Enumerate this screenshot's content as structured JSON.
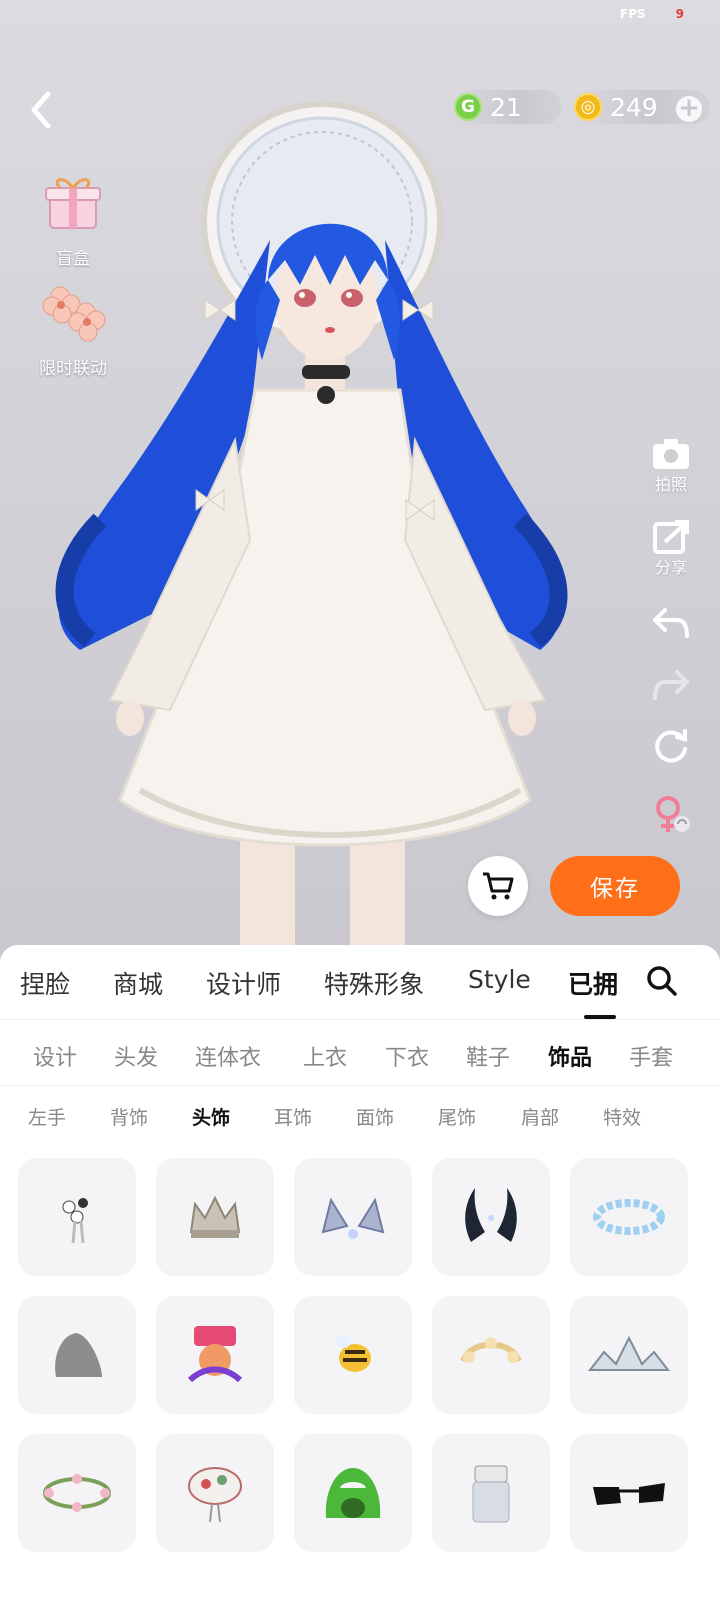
{
  "fps": {
    "label": "FPS",
    "value": "9"
  },
  "currency": {
    "green": "21",
    "gold": "249"
  },
  "side_events": [
    {
      "label": "盲盒",
      "icon": "gift-box-icon"
    },
    {
      "label": "限时联动",
      "icon": "flower-icon"
    }
  ],
  "right_tools": [
    {
      "label": "拍照",
      "icon": "camera-icon"
    },
    {
      "label": "分享",
      "icon": "share-icon"
    },
    {
      "label": "",
      "icon": "undo-icon"
    },
    {
      "label": "",
      "icon": "redo-icon"
    },
    {
      "label": "",
      "icon": "reset-icon"
    },
    {
      "label": "",
      "icon": "gender-switch-icon"
    }
  ],
  "save_label": "保存",
  "main_tabs": [
    {
      "label": "捏脸"
    },
    {
      "label": "商城"
    },
    {
      "label": "设计师"
    },
    {
      "label": "特殊形象"
    },
    {
      "label": "Style"
    },
    {
      "label": "已拥"
    }
  ],
  "sub_tabs": [
    {
      "label": "设计"
    },
    {
      "label": "头发"
    },
    {
      "label": "连体衣"
    },
    {
      "label": "上衣"
    },
    {
      "label": "下衣"
    },
    {
      "label": "鞋子"
    },
    {
      "label": "饰品"
    },
    {
      "label": "手套"
    }
  ],
  "third_tabs": [
    {
      "label": "左手"
    },
    {
      "label": "背饰"
    },
    {
      "label": "头饰"
    },
    {
      "label": "耳饰"
    },
    {
      "label": "面饰"
    },
    {
      "label": "尾饰"
    },
    {
      "label": "肩部"
    },
    {
      "label": "特效"
    }
  ],
  "items": [
    {
      "name": "flower-headpiece"
    },
    {
      "name": "silver-crown"
    },
    {
      "name": "cat-ears"
    },
    {
      "name": "dark-horns"
    },
    {
      "name": "blue-flower-wreath"
    },
    {
      "name": "grey-hat"
    },
    {
      "name": "233-robot-headband"
    },
    {
      "name": "bee-hairclip"
    },
    {
      "name": "flower-crown"
    },
    {
      "name": "silver-tiara"
    },
    {
      "name": "pink-flower-wreath"
    },
    {
      "name": "floral-beret"
    },
    {
      "name": "green-dino-hood"
    },
    {
      "name": "visor"
    },
    {
      "name": "black-sunglasses"
    }
  ]
}
